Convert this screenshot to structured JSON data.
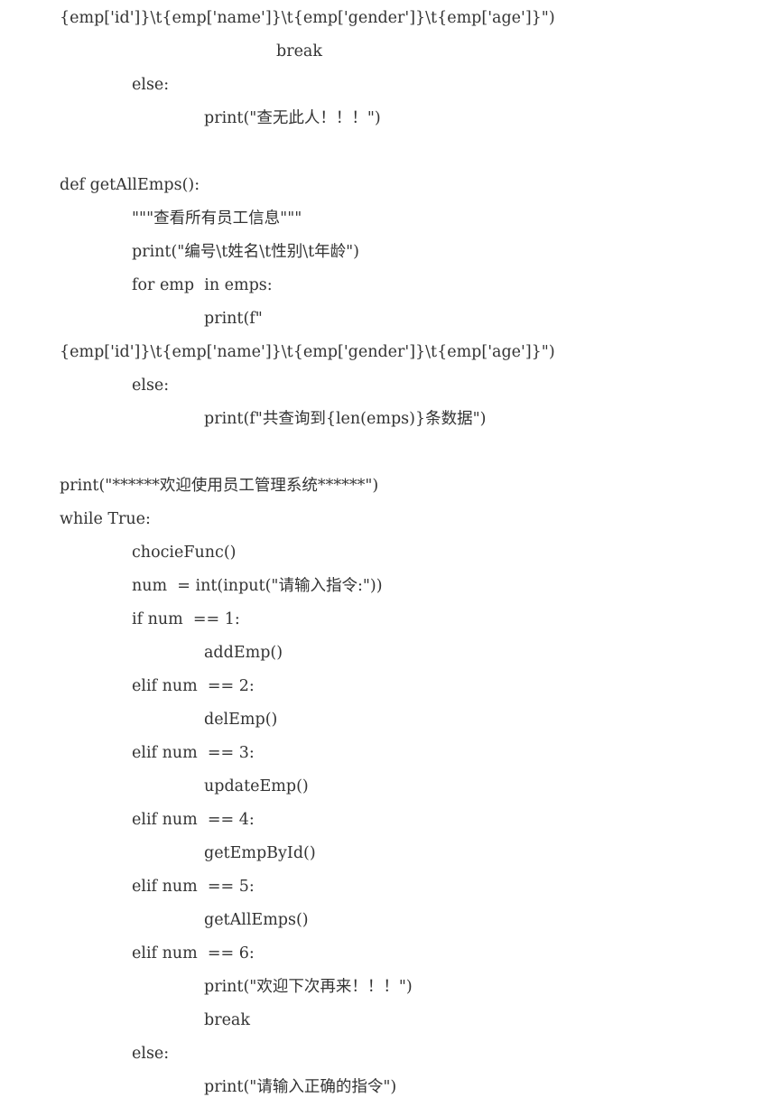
{
  "code": {
    "lines": [
      {
        "text": "{emp['id']}\\t{emp['name']}\\t{emp['gender']}\\t{emp['age']}\")",
        "indent": 0
      },
      {
        "text": "break",
        "indent": 3
      },
      {
        "text": "else:",
        "indent": 1
      },
      {
        "text": "print(\"查无此人！！！\")",
        "indent": 2
      },
      {
        "text": "",
        "indent": 0
      },
      {
        "text": "def getAllEmps():",
        "indent": 0
      },
      {
        "text": "\"\"\"查看所有员工信息\"\"\"",
        "indent": 1
      },
      {
        "text": "print(\"编号\\t姓名\\t性别\\t年龄\")",
        "indent": 1
      },
      {
        "text": "for emp  in emps:",
        "indent": 1
      },
      {
        "text": "print(f\"",
        "indent": 2
      },
      {
        "text": "{emp['id']}\\t{emp['name']}\\t{emp['gender']}\\t{emp['age']}\")",
        "indent": 0
      },
      {
        "text": "else:",
        "indent": 1
      },
      {
        "text": "print(f\"共查询到{len(emps)}条数据\")",
        "indent": 2
      },
      {
        "text": "",
        "indent": 0
      },
      {
        "text": "print(\"******欢迎使用员工管理系统******\")",
        "indent": 0
      },
      {
        "text": "while True:",
        "indent": 0
      },
      {
        "text": "chocieFunc()",
        "indent": 1
      },
      {
        "text": "num  = int(input(\"请输入指令:\"))",
        "indent": 1
      },
      {
        "text": "if num  == 1:",
        "indent": 1
      },
      {
        "text": "addEmp()",
        "indent": 2
      },
      {
        "text": "elif num  == 2:",
        "indent": 1
      },
      {
        "text": "delEmp()",
        "indent": 2
      },
      {
        "text": "elif num  == 3:",
        "indent": 1
      },
      {
        "text": "updateEmp()",
        "indent": 2
      },
      {
        "text": "elif num  == 4:",
        "indent": 1
      },
      {
        "text": "getEmpById()",
        "indent": 2
      },
      {
        "text": "elif num  == 5:",
        "indent": 1
      },
      {
        "text": "getAllEmps()",
        "indent": 2
      },
      {
        "text": "elif num  == 6:",
        "indent": 1
      },
      {
        "text": "print(\"欢迎下次再来！！！\")",
        "indent": 2
      },
      {
        "text": "break",
        "indent": 2
      },
      {
        "text": "else:",
        "indent": 1
      },
      {
        "text": "print(\"请输入正确的指令\")",
        "indent": 2
      }
    ]
  }
}
